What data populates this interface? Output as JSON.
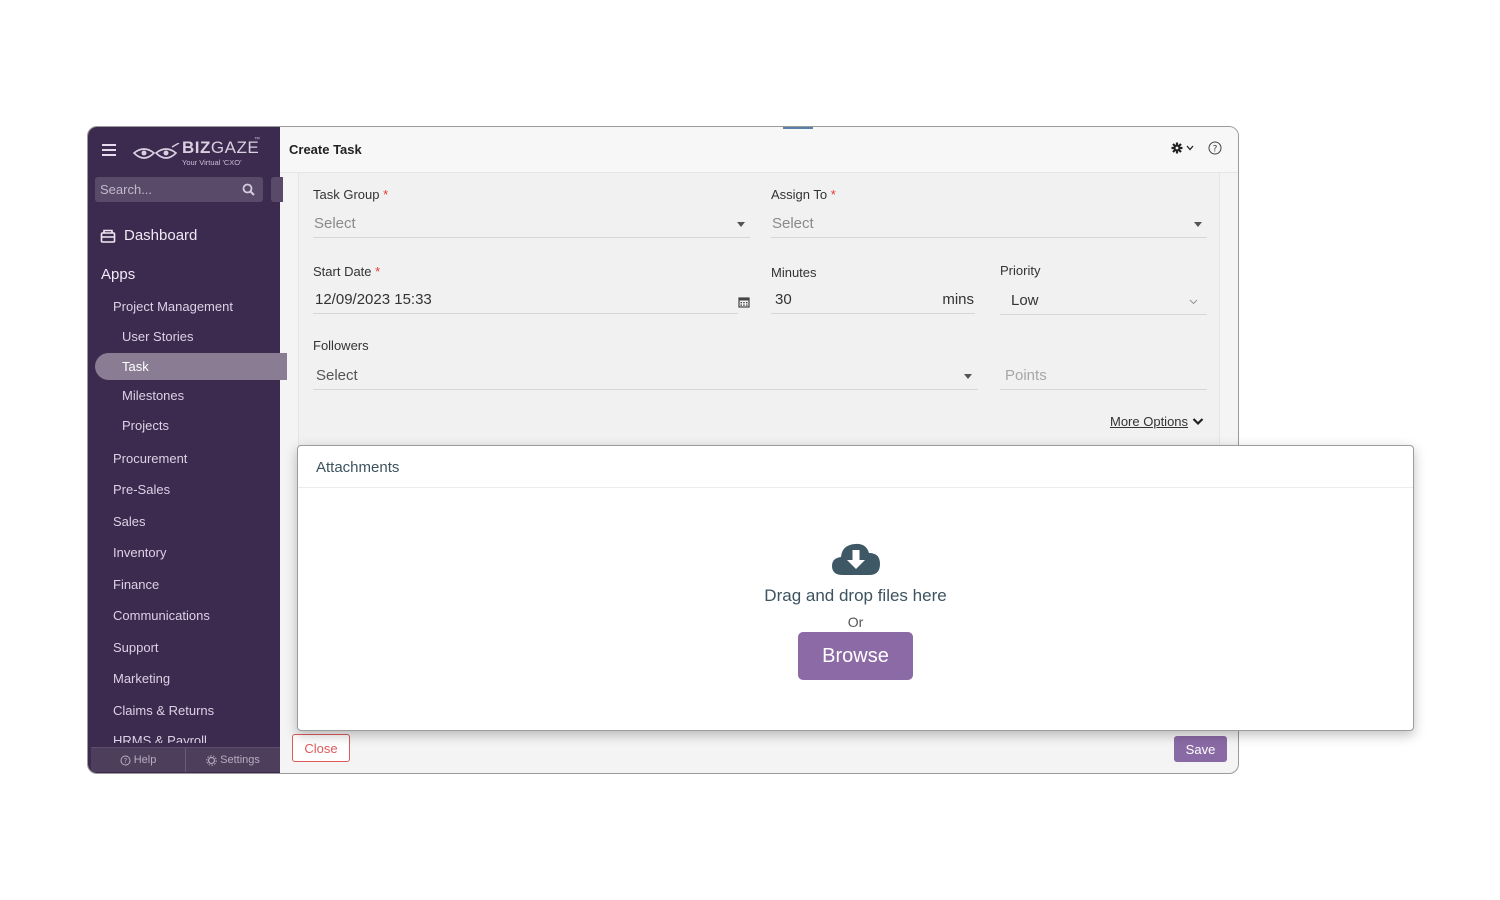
{
  "brand": {
    "logo_text_bold": "BIZ",
    "logo_text_light": "GAZE",
    "trademark": "™",
    "tagline": "Your Virtual 'CXO'"
  },
  "sidebar": {
    "search_placeholder": "Search...",
    "dashboard_label": "Dashboard",
    "apps_label": "Apps",
    "group": "Project Management",
    "sub_items": [
      "User Stories",
      "Task",
      "Milestones",
      "Projects"
    ],
    "active_item": "Task",
    "items": [
      "Procurement",
      "Pre-Sales",
      "Sales",
      "Inventory",
      "Finance",
      "Communications",
      "Support",
      "Marketing",
      "Claims & Returns",
      "HRMS & Payroll"
    ],
    "footer": {
      "help_label": "Help",
      "settings_label": "Settings"
    }
  },
  "header": {
    "title": "Create Task"
  },
  "form": {
    "task_group": {
      "label": "Task Group",
      "required_mark": "*",
      "placeholder": "Select"
    },
    "assign_to": {
      "label": "Assign To",
      "required_mark": "*",
      "placeholder": "Select"
    },
    "start_date": {
      "label": "Start Date",
      "required_mark": "*",
      "value": "12/09/2023 15:33"
    },
    "minutes": {
      "label": "Minutes",
      "value": "30",
      "unit": "mins"
    },
    "priority": {
      "label": "Priority",
      "value": "Low"
    },
    "followers": {
      "label": "Followers",
      "placeholder": "Select"
    },
    "points": {
      "placeholder": "Points"
    },
    "more_options_label": "More Options"
  },
  "buttons": {
    "close_label": "Close",
    "save_label": "Save"
  },
  "attachments": {
    "title": "Attachments",
    "drag_text": "Drag and drop files here",
    "or_text": "Or",
    "browse_label": "Browse"
  },
  "colors": {
    "sidebar_bg": "#3d2a4f",
    "accent_purple": "#8c6aa6",
    "close_red": "#e05a5a",
    "required_red": "#e53935"
  }
}
